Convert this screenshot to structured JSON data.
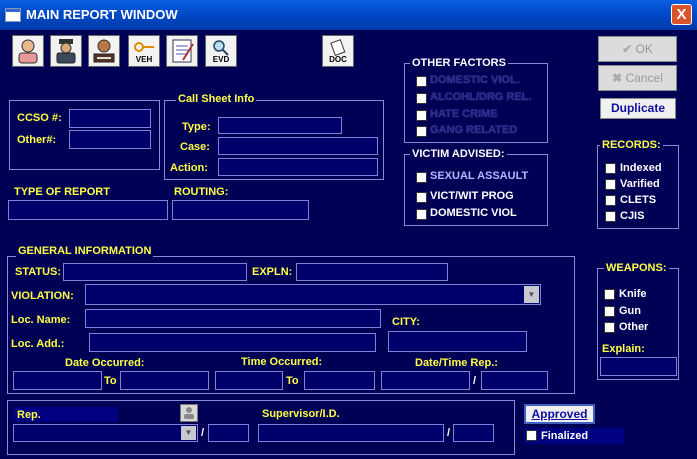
{
  "window": {
    "title": "MAIN REPORT WINDOW",
    "close_label": "X"
  },
  "toolbar": {
    "veh": "VEH",
    "evd": "EVD",
    "doc": "DOC"
  },
  "buttons": {
    "ok": "OK",
    "cancel": "Cancel",
    "duplicate": "Duplicate",
    "approved": "Approved"
  },
  "ids": {
    "ccso": "CCSO #:",
    "other": "Other#:"
  },
  "call_sheet": {
    "title": "Call Sheet Info",
    "type": "Type:",
    "case": "Case:",
    "action": "Action:"
  },
  "report": {
    "type_of_report": "TYPE OF REPORT",
    "routing": "ROUTING:"
  },
  "other_factors": {
    "title": "OTHER FACTORS",
    "items": [
      "DOMESTIC VIOL.",
      "ALCOHL/DRG REL.",
      "HATE CRIME",
      "GANG RELATED"
    ]
  },
  "victim_advised": {
    "title": "VICTIM ADVISED:",
    "items": [
      "SEXUAL ASSAULT",
      "VICT/WIT PROG",
      "DOMESTIC VIOL"
    ]
  },
  "records": {
    "title": "RECORDS:",
    "items": [
      "Indexed",
      "Varified",
      "CLETS",
      "CJIS"
    ]
  },
  "weapons": {
    "title": "WEAPONS:",
    "items": [
      "Knife",
      "Gun",
      "Other"
    ],
    "explain": "Explain:"
  },
  "general": {
    "title": "GENERAL INFORMATION",
    "status": "STATUS:",
    "expln": "EXPLN:",
    "violation": "VIOLATION:",
    "loc_name": "Loc. Name:",
    "city": "CITY:",
    "loc_add": "Loc. Add.:",
    "date_occurred": "Date Occurred:",
    "time_occurred": "Time Occurred:",
    "date_time_rep": "Date/Time Rep.:",
    "to": "To",
    "slash": "/"
  },
  "footer": {
    "rep": "Rep.",
    "supervisor": "Supervisor/I.D.",
    "finalized": "Finalized",
    "slash": "/"
  }
}
